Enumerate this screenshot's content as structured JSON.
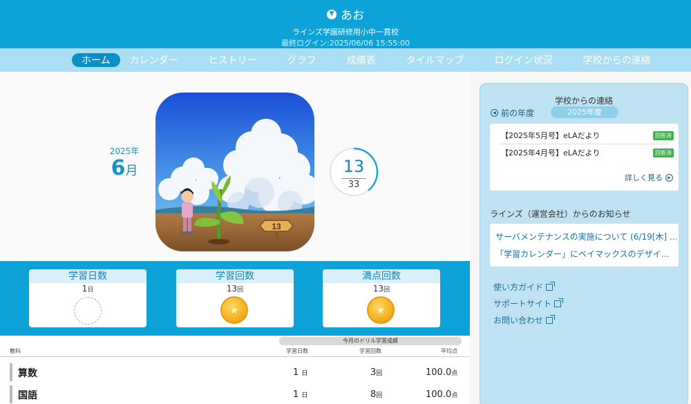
{
  "header": {
    "user_name": "あお",
    "school": "ラインズ学園研修用小中一貫校",
    "last_login": "最終ログイン:2025/06/06 15:55:00"
  },
  "nav": {
    "items": [
      "ホーム",
      "カレンダー",
      "ヒストリー",
      "グラフ",
      "成績表",
      "タイルマップ",
      "ログイン状況",
      "学校からの連絡"
    ]
  },
  "hero": {
    "year": "2025",
    "year_suffix": "年",
    "month": "6",
    "month_suffix": "月",
    "sign_number": "13",
    "counter_current": "13",
    "counter_total": "33"
  },
  "stats": [
    {
      "title": "学習日数",
      "value": "1",
      "unit": "日"
    },
    {
      "title": "学習回数",
      "value": "13",
      "unit": "回"
    },
    {
      "title": "満点回数",
      "value": "13",
      "unit": "回"
    }
  ],
  "table": {
    "caption": "今月のドリル学習成績",
    "headers": [
      "教科",
      "学習日数",
      "学習回数",
      "平均点"
    ],
    "rows": [
      {
        "subject": "算数",
        "days": "1",
        "days_unit": "日",
        "count": "3",
        "count_unit": "回",
        "avg": "100.0",
        "avg_unit": "点"
      },
      {
        "subject": "国語",
        "days": "1",
        "days_unit": "日",
        "count": "8",
        "count_unit": "回",
        "avg": "100.0",
        "avg_unit": "点"
      }
    ]
  },
  "sidebar": {
    "title": "学校からの連絡",
    "prev_year": "前の年度",
    "current_year": "2025年度",
    "notices": [
      {
        "text": "【2025年5月号】eLAだより",
        "badge": "回答済"
      },
      {
        "text": "【2025年4月号】eLAだより",
        "badge": "回答済"
      }
    ],
    "more": "詳しく見る",
    "ops_title": "ラインズ（運営会社）からのお知らせ",
    "ops_items": [
      "サーバメンテナンスの実施について (6/19[木] …",
      "「学習カレンダー」にベイマックスのデザイ…"
    ],
    "links": [
      "使い方ガイド",
      "サポートサイト",
      "お問い合わせ"
    ]
  }
}
